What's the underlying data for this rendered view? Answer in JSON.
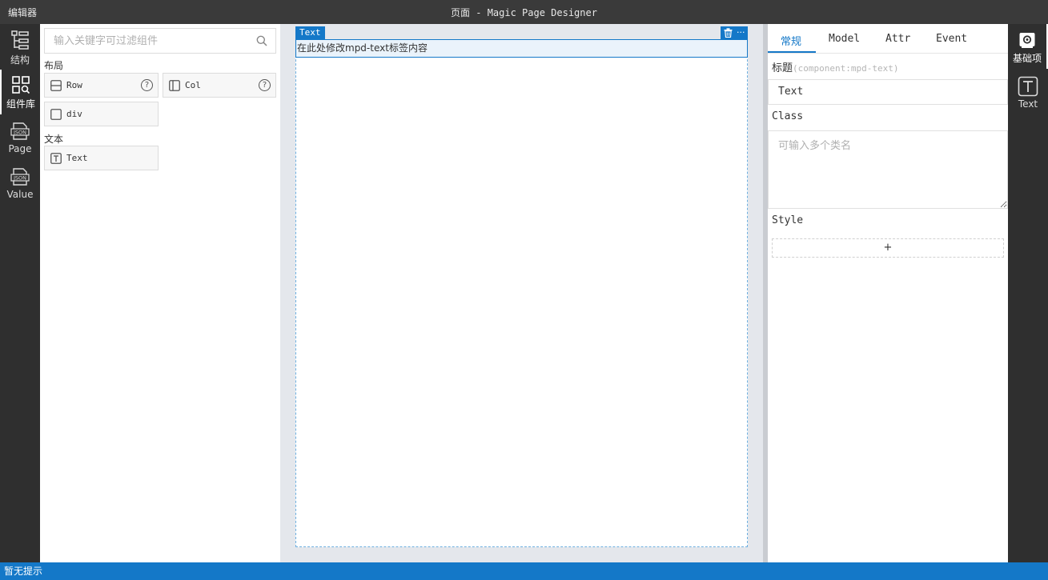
{
  "titlebar": {
    "app_name": "编辑器",
    "title": "页面 - Magic Page Designer"
  },
  "leftbar": {
    "items": [
      {
        "label": "结构",
        "icon": "tree-structure-icon"
      },
      {
        "label": "组件库",
        "icon": "component-library-icon"
      },
      {
        "label": "Page",
        "icon": "json-file-icon"
      },
      {
        "label": "Value",
        "icon": "json-file-icon"
      }
    ],
    "active": "组件库"
  },
  "library": {
    "search_placeholder": "输入关键字可过滤组件",
    "groups": [
      {
        "title": "布局",
        "components": [
          {
            "name": "Row",
            "icon": "row-layout-icon",
            "has_help": true
          },
          {
            "name": "Col",
            "icon": "column-layout-icon",
            "has_help": true
          },
          {
            "name": "div",
            "icon": "square-icon",
            "has_help": false
          }
        ]
      },
      {
        "title": "文本",
        "components": [
          {
            "name": "Text",
            "icon": "text-t-icon",
            "has_help": false
          }
        ]
      }
    ],
    "help_glyph": "?"
  },
  "canvas": {
    "selected_tag": "Text",
    "selected_text": "在此处修改mpd-text标签内容",
    "tools": {
      "delete": "delete-icon",
      "more": "···"
    }
  },
  "props": {
    "tabs": [
      "常规",
      "Model",
      "Attr",
      "Event"
    ],
    "active_tab": "常规",
    "title_label": "标题",
    "title_hint": "(component:mpd-text)",
    "title_value": "Text",
    "class_label": "Class",
    "class_placeholder": "可输入多个类名",
    "style_label": "Style",
    "add_style": "+"
  },
  "rightbar": {
    "items": [
      {
        "label": "基础项",
        "icon": "settings-gear-icon"
      },
      {
        "label": "Text",
        "icon": "text-t-icon"
      }
    ],
    "active": "基础项"
  },
  "status": {
    "message": "暂无提示"
  },
  "colors": {
    "accent": "#1478c8",
    "dark_bar": "#2f2f2f",
    "titlebar": "#3a3a3a",
    "canvas_bg": "#e4e7ec"
  }
}
